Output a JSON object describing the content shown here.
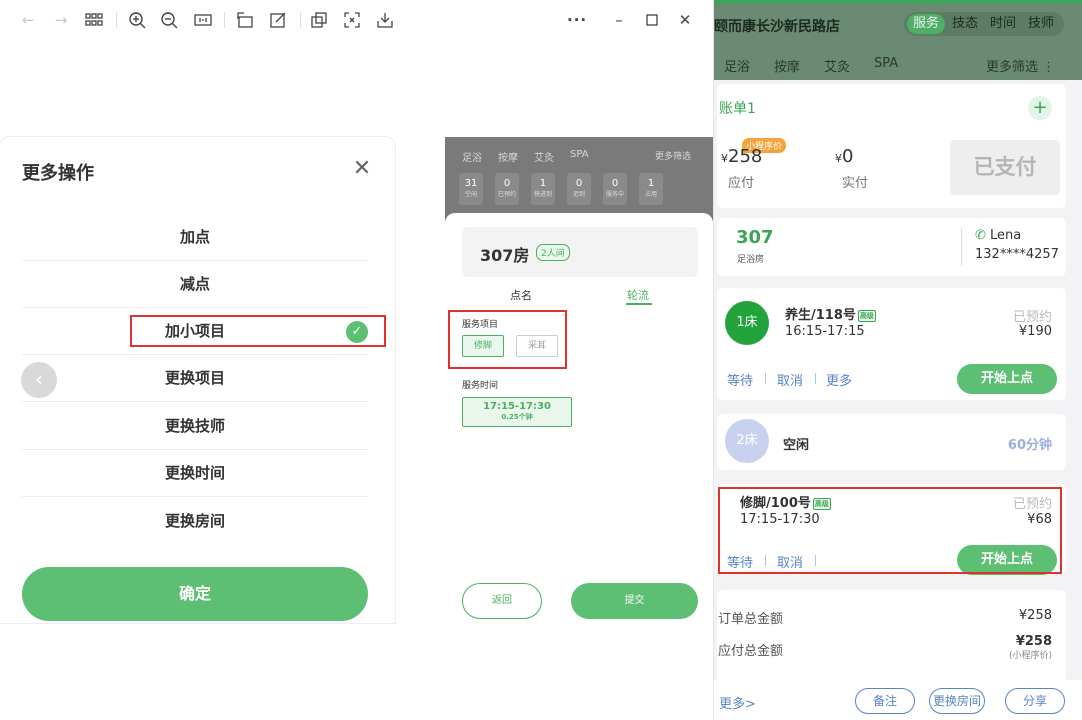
{
  "viewer": {
    "toolbar_icons": [
      "back-arrow-icon",
      "forward-arrow-icon",
      "grid-icon",
      "zoom-in-icon",
      "zoom-out-icon",
      "fit-icon",
      "rotate-icon",
      "edit-icon",
      "copy-icon",
      "crop-icon",
      "download-icon",
      "more-icon",
      "minimize-icon",
      "maximize-icon",
      "close-icon"
    ]
  },
  "dialog": {
    "title": "更多操作",
    "options": [
      "加点",
      "减点",
      "加小项目",
      "更换项目",
      "更换技师",
      "更换时间",
      "更换房间"
    ],
    "confirm_label": "确定"
  },
  "preview": {
    "tabs": [
      "足浴",
      "按摩",
      "艾灸",
      "SPA"
    ],
    "more_filter": "更多筛选",
    "stats": [
      {
        "num": "31",
        "label": "空闲"
      },
      {
        "num": "0",
        "label": "已预约"
      },
      {
        "num": "1",
        "label": "快进到"
      },
      {
        "num": "0",
        "label": "迟到"
      },
      {
        "num": "0",
        "label": "服务中"
      },
      {
        "num": "1",
        "label": "占用"
      }
    ],
    "room": "307房",
    "room_tag": "2人间",
    "sub_tabs": [
      "点名",
      "轮流"
    ],
    "service_label": "服务项目",
    "chips": [
      "修脚",
      "采耳"
    ],
    "time_label": "服务时间",
    "time_range": "17:15-17:30",
    "time_clock": "0.25个钟",
    "back_label": "返回",
    "submit_label": "提交"
  },
  "app": {
    "store_name": "颐而康长沙新民路店",
    "segments": [
      "服务",
      "技态",
      "时间",
      "技师"
    ],
    "categories": [
      "足浴",
      "按摩",
      "艾灸",
      "SPA"
    ],
    "more_filter": "更多筛选",
    "bill": {
      "title": "账单1",
      "payable_amount": "258",
      "payable_label": "应付",
      "actual_amount": "0",
      "actual_label": "实付",
      "currency": "¥",
      "mini_tag": "小程序价",
      "paid_label": "已支付"
    },
    "room": {
      "number": "307",
      "type": "足浴房",
      "customer": "Lena",
      "phone": "132****4257"
    },
    "beds": [
      {
        "badge": "1床",
        "service": "养生/118号",
        "level": "高级",
        "time": "16:15-17:15",
        "status": "已预约",
        "price": "¥190",
        "actions": [
          "等待",
          "取消",
          "更多"
        ],
        "start_label": "开始上点"
      },
      {
        "badge": "2床",
        "service": "空闲",
        "duration": "60分钟"
      },
      {
        "service": "修脚/100号",
        "level": "高级",
        "time": "17:15-17:30",
        "status": "已预约",
        "price": "¥68",
        "actions": [
          "等待",
          "取消"
        ],
        "start_label": "开始上点"
      }
    ],
    "summary": {
      "order_total_label": "订单总金额",
      "order_total": "¥258",
      "payable_total_label": "应付总金额",
      "payable_total": "¥258",
      "payable_note": "(小程序价)"
    },
    "footer": {
      "more": "更多>",
      "buttons": [
        "备注",
        "更换房间",
        "分享"
      ]
    }
  }
}
